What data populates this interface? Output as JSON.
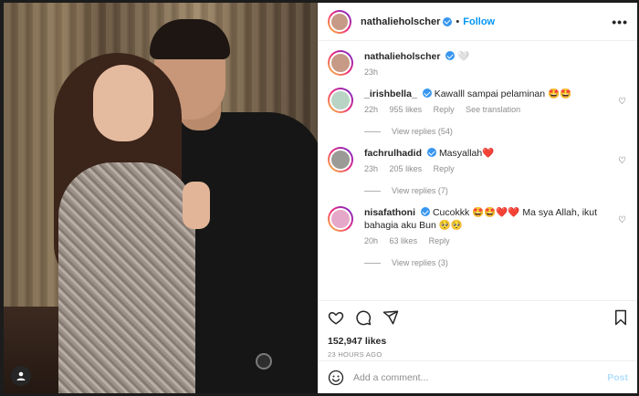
{
  "post": {
    "username": "nathalieholscher",
    "follow_label": "Follow",
    "separator": "•",
    "more_label": "•••"
  },
  "caption": {
    "username": "nathalieholscher",
    "text": "🤍",
    "time": "23h"
  },
  "comments": [
    {
      "username": "_irishbella_",
      "text": "Kawalll sampai pelaminan 🤩🤩",
      "time": "22h",
      "likes": "955 likes",
      "reply": "Reply",
      "translate": "See translation",
      "view_replies": "View replies (54)"
    },
    {
      "username": "fachrulhadid",
      "text": "Masyallah❤️",
      "time": "23h",
      "likes": "205 likes",
      "reply": "Reply",
      "view_replies": "View replies (7)"
    },
    {
      "username": "nisafathoni",
      "text": "Cucokkk 🤩🤩❤️❤️  Ma sya Allah, ikut bahagia aku Bun 🥺🥺",
      "time": "20h",
      "likes": "63 likes",
      "reply": "Reply",
      "view_replies": "View replies (3)"
    }
  ],
  "stats": {
    "likes": "152,947 likes",
    "ago": "23 HOURS AGO"
  },
  "comment_input": {
    "placeholder": "Add a comment...",
    "post_label": "Post"
  },
  "colors": {
    "accent": "#0095f6",
    "verified": "#3897f0"
  }
}
